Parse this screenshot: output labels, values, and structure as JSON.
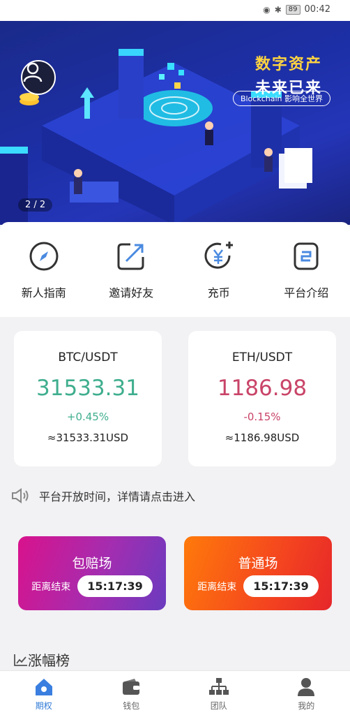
{
  "status_bar": {
    "battery": "89",
    "time": "00:42"
  },
  "banner": {
    "title_line1": "数字资产",
    "title_line2": "未来已来",
    "subtitle": "Blockchain 影响全世界",
    "pager": "2 / 2"
  },
  "quick_menu": [
    {
      "label": "新人指南",
      "icon": "compass-icon"
    },
    {
      "label": "邀请好友",
      "icon": "share-arrow-icon"
    },
    {
      "label": "充币",
      "icon": "yen-add-icon"
    },
    {
      "label": "平台介绍",
      "icon": "info-doc-icon"
    }
  ],
  "markets": [
    {
      "pair": "BTC/USDT",
      "price": "31533.31",
      "change": "+0.45%",
      "usd": "≈31533.31USD",
      "trend": "up"
    },
    {
      "pair": "ETH/USDT",
      "price": "1186.98",
      "change": "-0.15%",
      "usd": "≈1186.98USD",
      "trend": "down"
    }
  ],
  "notice": {
    "text": "平台开放时间，详情请点击进入"
  },
  "sessions": [
    {
      "name": "包赔场",
      "label": "距离结束",
      "timer": "15:17:39"
    },
    {
      "name": "普通场",
      "label": "距离结束",
      "timer": "15:17:39"
    }
  ],
  "ranking": {
    "title": "涨幅榜"
  },
  "tabs": [
    {
      "label": "期权",
      "active": true
    },
    {
      "label": "钱包",
      "active": false
    },
    {
      "label": "团队",
      "active": false
    },
    {
      "label": "我的",
      "active": false
    }
  ],
  "colors": {
    "up": "#3fae8e",
    "down": "#c94468",
    "active_tab": "#2f7ad6"
  }
}
